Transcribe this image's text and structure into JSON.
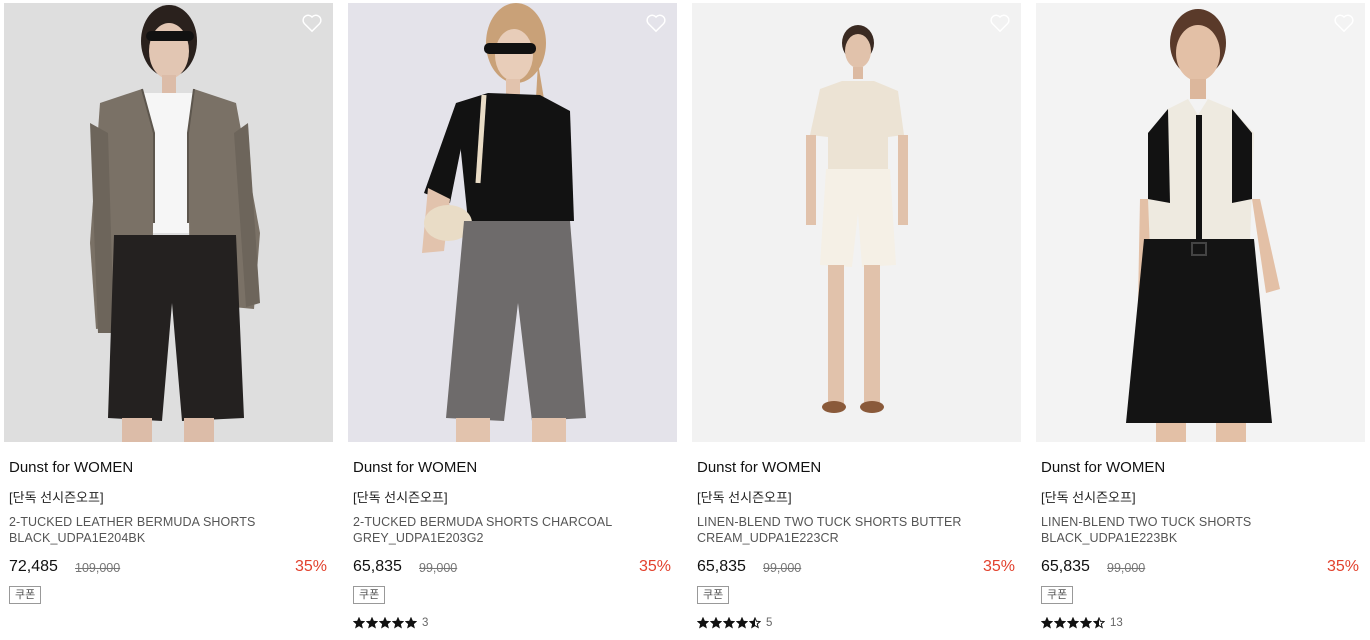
{
  "products": [
    {
      "brand": "Dunst for WOMEN",
      "promo": "[단독 선시즌오프]",
      "name": "2-TUCKED LEATHER BERMUDA SHORTS BLACK_UDPA1E204BK",
      "price": "72,485",
      "original_price": "109,000",
      "discount": "35%",
      "coupon": "쿠폰",
      "rating": null,
      "review_count": ""
    },
    {
      "brand": "Dunst for WOMEN",
      "promo": "[단독 선시즌오프]",
      "name": "2-TUCKED BERMUDA SHORTS CHARCOAL GREY_UDPA1E203G2",
      "price": "65,835",
      "original_price": "99,000",
      "discount": "35%",
      "coupon": "쿠폰",
      "rating": 5,
      "review_count": "3"
    },
    {
      "brand": "Dunst for WOMEN",
      "promo": "[단독 선시즌오프]",
      "name": "LINEN-BLEND TWO TUCK SHORTS BUTTER CREAM_UDPA1E223CR",
      "price": "65,835",
      "original_price": "99,000",
      "discount": "35%",
      "coupon": "쿠폰",
      "rating": 4.5,
      "review_count": "5"
    },
    {
      "brand": "Dunst for WOMEN",
      "promo": "[단독 선시즌오프]",
      "name": "LINEN-BLEND TWO TUCK SHORTS BLACK_UDPA1E223BK",
      "price": "65,835",
      "original_price": "99,000",
      "discount": "35%",
      "coupon": "쿠폰",
      "rating": 4.5,
      "review_count": "13"
    }
  ],
  "icons": {
    "wishlist": "heart-outline-icon",
    "star": "star-icon"
  },
  "colors": {
    "discount": "#e2412d",
    "text": "#111111",
    "star": "#111111"
  }
}
